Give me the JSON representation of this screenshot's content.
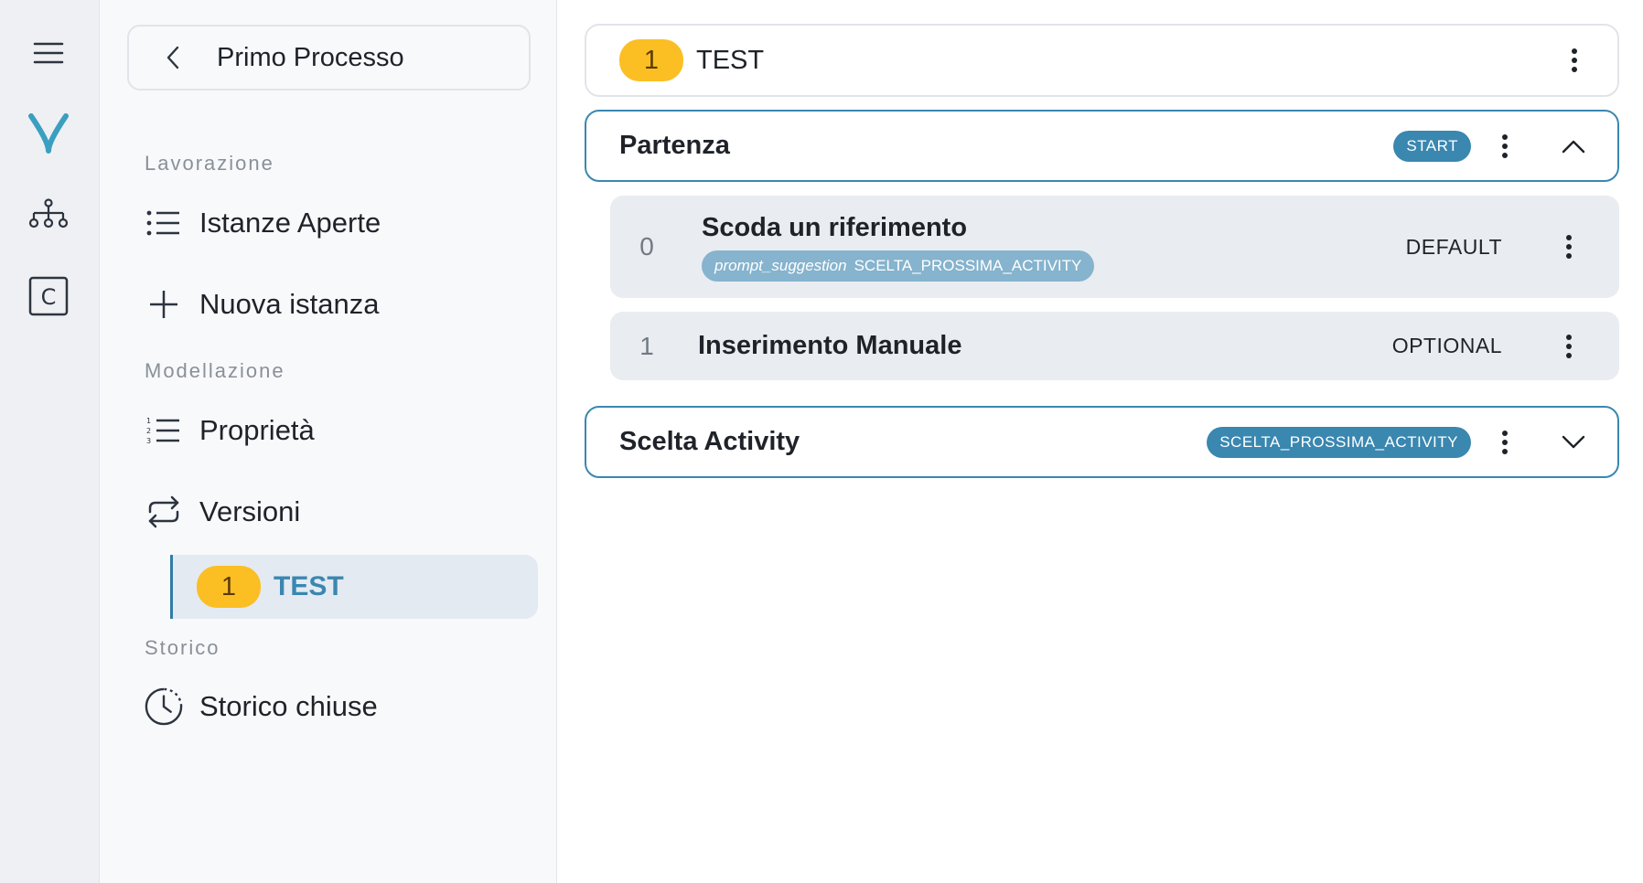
{
  "sidebar": {
    "process_title": "Primo Processo",
    "sections": {
      "lavorazione": "Lavorazione",
      "modellazione": "Modellazione",
      "storico": "Storico"
    },
    "items": {
      "istanze_aperte": "Istanze Aperte",
      "nuova_istanza": "Nuova istanza",
      "proprieta": "Proprietà",
      "versioni": "Versioni",
      "storico_chiuse": "Storico chiuse"
    },
    "active_version": {
      "number": "1",
      "label": "TEST"
    }
  },
  "main": {
    "version": {
      "number": "1",
      "label": "TEST"
    },
    "steps": [
      {
        "title": "Partenza",
        "badge": "START",
        "expanded": true,
        "activities": [
          {
            "index": "0",
            "title": "Scoda un riferimento",
            "type": "DEFAULT",
            "tag_key": "prompt_suggestion",
            "tag_value": "SCELTA_PROSSIMA_ACTIVITY"
          },
          {
            "index": "1",
            "title": "Inserimento Manuale",
            "type": "OPTIONAL"
          }
        ]
      },
      {
        "title": "Scelta Activity",
        "badge": "SCELTA_PROSSIMA_ACTIVITY",
        "expanded": false
      }
    ]
  },
  "colors": {
    "accent": "#3a87b0",
    "badge_yellow": "#fbbf24",
    "rail_bg": "#eef0f3",
    "sidebar_bg": "#f8f9fb",
    "activity_bg": "#e9ecf0",
    "selected_bg": "#e4eaf1"
  },
  "icons": {
    "rail": [
      "menu-icon",
      "app-logo-icon",
      "org-chart-icon",
      "c-box-icon"
    ],
    "nav": [
      "list-icon",
      "plus-icon",
      "numbered-list-icon",
      "repeat-icon",
      "clock-icon"
    ]
  }
}
